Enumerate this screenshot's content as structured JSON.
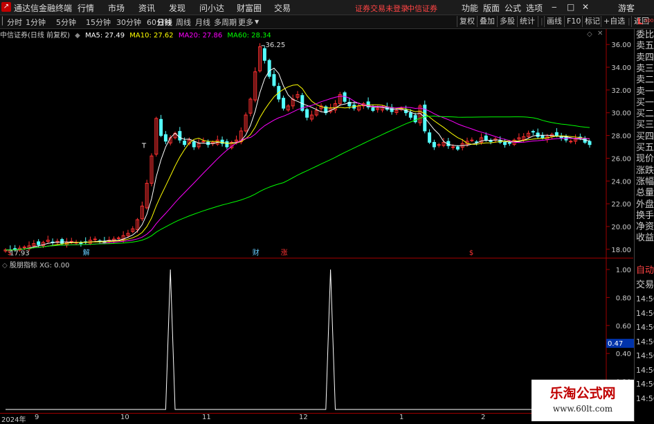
{
  "app": {
    "title": "通达信金融终端",
    "menu": [
      "行情",
      "市场",
      "资讯",
      "发现",
      "问小达",
      "财富圈",
      "交易"
    ],
    "notice": "证券交易未登录",
    "broker": "中信证券",
    "right_menu": [
      "功能",
      "版面",
      "公式",
      "选项"
    ],
    "window_controls": [
      "‒",
      "□",
      "✕"
    ],
    "guest": "游客"
  },
  "toolbar": {
    "periods": [
      "分时",
      "1分钟",
      "5分钟",
      "15分钟",
      "30分钟",
      "60分钟",
      "日线",
      "周线",
      "月线",
      "多周期",
      "更多"
    ],
    "active_period": "日线",
    "right_buttons": [
      "复权",
      "叠加",
      "多股",
      "统计",
      "画线",
      "F10",
      "标记",
      "+自选",
      "返回"
    ]
  },
  "chart_header": {
    "stock": "中信证券(日线 前复权)",
    "ma5": "MA5: 27.49",
    "ma10": "MA10: 27.62",
    "ma20": "MA20: 27.86",
    "ma60": "MA60: 28.34",
    "colors": {
      "ma5": "#ffffff",
      "ma10": "#ffff00",
      "ma20": "#ff00ff",
      "ma60": "#00ff00"
    }
  },
  "price_axis": [
    "36.00",
    "34.00",
    "32.00",
    "30.00",
    "28.00",
    "26.00",
    "24.00",
    "22.00",
    "20.00",
    "18.00"
  ],
  "price_labels": {
    "high": "36.25",
    "low": "17.93"
  },
  "event_markers": [
    {
      "text": "$",
      "color": "#ff3333"
    },
    {
      "text": "解",
      "color": "#66ccff"
    },
    {
      "text": "财",
      "color": "#66ccff"
    },
    {
      "text": "涨",
      "color": "#ff3333"
    },
    {
      "text": "$",
      "color": "#ff3333"
    }
  ],
  "indicator": {
    "name": "股朋指标",
    "value": "XG: 0.00",
    "axis": [
      "1.00",
      "0.80",
      "0.60",
      "0.47",
      "0.40",
      "0.20"
    ],
    "current": "0.47"
  },
  "date_axis": [
    "2024年",
    "9",
    "10",
    "11",
    "12",
    "1",
    "2"
  ],
  "side_panel": [
    "委比",
    "卖五",
    "卖四",
    "卖三",
    "卖二",
    "卖一",
    "买一",
    "买二",
    "买三",
    "买四",
    "买五",
    "现价",
    "涨跌",
    "涨幅",
    "总量",
    "外盘",
    "换手",
    "净资",
    "收益"
  ],
  "side_panel_lower": [
    "自动",
    "交易",
    "14:56",
    "14:56",
    "14:56",
    "14:56",
    "14:56",
    "14:56",
    "14:56",
    "14:56"
  ],
  "top_right": {
    "letter": "L",
    "sub": "300"
  },
  "watermark": {
    "line1": "乐淘公式网",
    "line2": "www.60lt.com"
  },
  "chart_data": [
    {
      "type": "candlestick",
      "title": "中信证券(日线 前复权)",
      "ylim": [
        17.5,
        36.5
      ],
      "y_ticks": [
        18,
        20,
        22,
        24,
        26,
        28,
        30,
        32,
        34,
        36
      ],
      "x_ticks": [
        "2024年",
        "9",
        "10",
        "11",
        "12",
        "1",
        "2"
      ],
      "annotations": [
        "36.25",
        "17.93"
      ],
      "closes": [
        17.95,
        17.9,
        18.0,
        18.1,
        18.2,
        18.3,
        18.5,
        18.4,
        18.6,
        18.8,
        18.6,
        18.7,
        18.5,
        18.6,
        18.7,
        18.6,
        18.5,
        18.6,
        18.8,
        18.9,
        18.7,
        18.6,
        18.8,
        18.9,
        19.0,
        19.2,
        19.4,
        19.8,
        20.6,
        21.8,
        23.8,
        26.2,
        29.5,
        28.0,
        27.5,
        27.8,
        28.2,
        27.6,
        27.2,
        27.6,
        27.0,
        27.3,
        27.5,
        27.2,
        27.4,
        27.6,
        27.3,
        27.0,
        27.4,
        27.6,
        28.4,
        29.8,
        31.2,
        33.6,
        35.8,
        34.6,
        33.2,
        32.4,
        31.2,
        30.4,
        30.6,
        31.2,
        31.6,
        30.2,
        29.6,
        29.8,
        30.2,
        30.6,
        30.0,
        30.4,
        30.8,
        31.6,
        31.0,
        30.6,
        30.4,
        30.6,
        30.8,
        30.5,
        30.2,
        30.4,
        30.5,
        30.3,
        30.1,
        30.2,
        30.4,
        30.0,
        29.6,
        29.2,
        30.6,
        28.4,
        27.4,
        27.0,
        27.2,
        27.4,
        27.1,
        27.0,
        26.8,
        27.3,
        27.5,
        27.6,
        27.4,
        27.8,
        27.6,
        27.5,
        27.7,
        27.4,
        27.2,
        27.3,
        27.6,
        27.8,
        27.9,
        28.2,
        28.3,
        27.9,
        27.8,
        27.9,
        28.1,
        28.0,
        27.8,
        27.6,
        27.5,
        27.7,
        27.8,
        27.4,
        27.2
      ],
      "series": [
        {
          "name": "MA5",
          "value": 27.49
        },
        {
          "name": "MA10",
          "value": 27.62
        },
        {
          "name": "MA20",
          "value": 27.86
        },
        {
          "name": "MA60",
          "value": 28.34
        }
      ]
    },
    {
      "type": "line",
      "title": "股朋指标",
      "series": [
        {
          "name": "XG",
          "signals": [
            35,
            69
          ]
        }
      ],
      "ylim": [
        0,
        1.0
      ],
      "y_ticks": [
        1.0,
        0.8,
        0.6,
        0.4,
        0.2
      ]
    }
  ]
}
